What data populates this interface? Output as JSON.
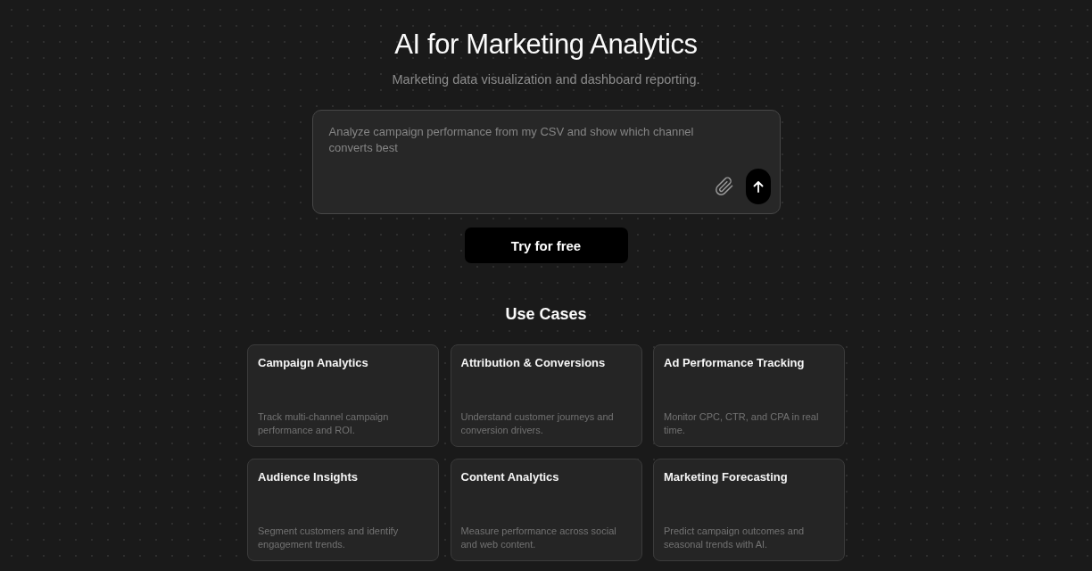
{
  "hero": {
    "title": "AI for Marketing Analytics",
    "subtitle": "Marketing data visualization and dashboard reporting."
  },
  "prompt": {
    "placeholder": "Analyze campaign performance from my CSV and show which channel converts best"
  },
  "cta_button": {
    "label": "Try for free"
  },
  "use_cases": {
    "heading": "Use Cases",
    "cards": [
      {
        "title": "Campaign Analytics",
        "description": "Track multi-channel campaign performance and ROI."
      },
      {
        "title": "Attribution & Conversions",
        "description": "Understand customer journeys and conversion drivers."
      },
      {
        "title": "Ad Performance Tracking",
        "description": "Monitor CPC, CTR, and CPA in real time."
      },
      {
        "title": "Audience Insights",
        "description": "Segment customers and identify engagement trends."
      },
      {
        "title": "Content Analytics",
        "description": "Measure performance across social and web content."
      },
      {
        "title": "Marketing Forecasting",
        "description": "Predict campaign outcomes and seasonal trends with AI."
      }
    ]
  }
}
